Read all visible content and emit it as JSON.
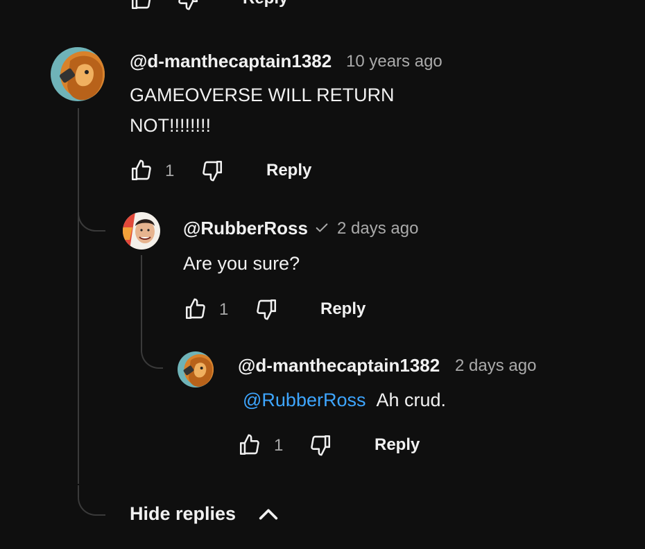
{
  "previous_comment": {
    "reply_label": "Reply"
  },
  "comments": [
    {
      "username": "@d-manthecaptain1382",
      "timestamp": "10 years ago",
      "text_lines": [
        "GAMEOVERSE WILL RETURN",
        "NOT!!!!!!!!"
      ],
      "likes": "1",
      "reply_label": "Reply",
      "avatar_icon": "lion-avatar"
    },
    {
      "username": "@RubberRoss",
      "verified": true,
      "verified_icon": "checkmark-icon",
      "timestamp": "2 days ago",
      "text": "Are you sure?",
      "likes": "1",
      "reply_label": "Reply",
      "avatar_icon": "person-avatar"
    },
    {
      "username": "@d-manthecaptain1382",
      "timestamp": "2 days ago",
      "mention": "@RubberRoss",
      "text": "Ah crud.",
      "likes": "1",
      "reply_label": "Reply",
      "avatar_icon": "lion-avatar"
    }
  ],
  "hide_replies_label": "Hide replies",
  "colors": {
    "background": "#0f0f0f",
    "text": "#f1f1f1",
    "secondary_text": "#aaaaaa",
    "mention": "#3ea6ff",
    "thread_line": "#3a3a3a"
  }
}
